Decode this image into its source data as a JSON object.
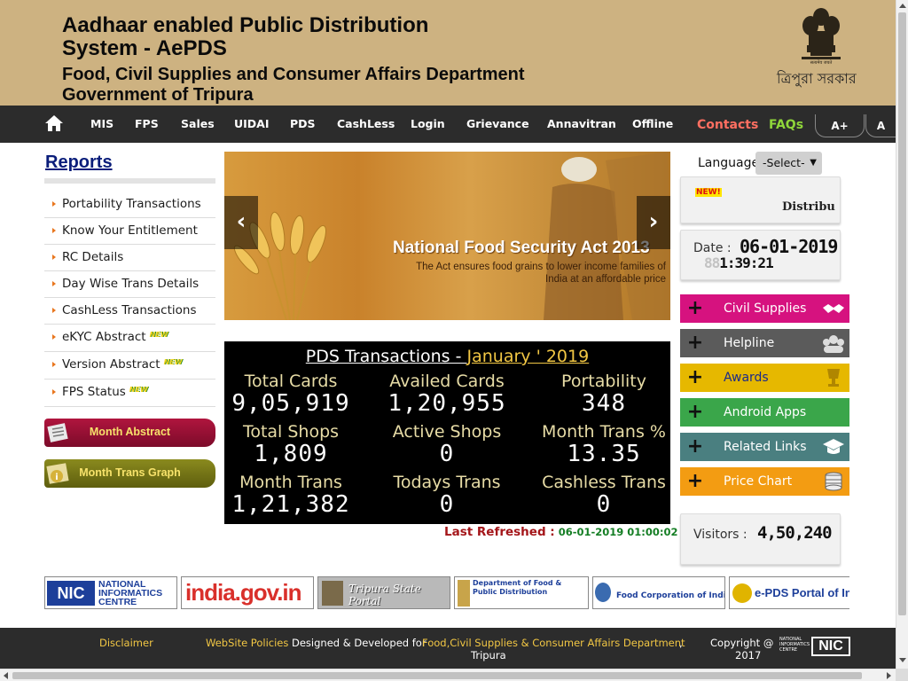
{
  "header": {
    "title": "Aadhaar enabled Public Distribution System - AePDS",
    "department": "Food, Civil Supplies and Consumer Affairs Department",
    "government": "Government of Tripura",
    "emblem_caption": "ত্রিপুরা সরকার",
    "bg_color": "#cdb281"
  },
  "nav": {
    "home_icon": "home-icon",
    "items": [
      "MIS",
      "FPS",
      "Sales",
      "UIDAI",
      "PDS",
      "CashLess",
      "Login",
      "Grievance",
      "Annavitran",
      "Offline"
    ],
    "contacts": "Contacts",
    "faqs": "FAQs",
    "font_increase": "A+",
    "font_normal": "A"
  },
  "reports": {
    "title": "Reports",
    "items": [
      {
        "label": "Portability Transactions",
        "new": false
      },
      {
        "label": "Know Your Entitlement",
        "new": false
      },
      {
        "label": "RC Details",
        "new": false
      },
      {
        "label": "Day Wise Trans Details",
        "new": false
      },
      {
        "label": "CashLess Transactions",
        "new": false
      },
      {
        "label": "eKYC Abstract",
        "new": true
      },
      {
        "label": "Version Abstract",
        "new": true
      },
      {
        "label": "FPS Status",
        "new": true
      }
    ],
    "new_badge": "NEW",
    "month_abstract": "Month Abstract",
    "month_trans_graph": "Month Trans Graph"
  },
  "banner": {
    "title": "National Food Security Act 2013",
    "subtitle": "The Act ensures food grains to lower income families of India at an affordable price",
    "prev": "‹",
    "next": "›"
  },
  "stats": {
    "heading_label": "PDS Transactions - ",
    "heading_month": "January ' 2019",
    "cells": [
      {
        "label": "Total Cards",
        "value": "9,05,919"
      },
      {
        "label": "Availed Cards",
        "value": "1,20,955"
      },
      {
        "label": "Portability",
        "value": "348"
      },
      {
        "label": "Total Shops",
        "value": "1,809"
      },
      {
        "label": "Active Shops",
        "value": "0"
      },
      {
        "label": "Month Trans %",
        "value": "13.35"
      },
      {
        "label": "Month Trans",
        "value": "1,21,382"
      },
      {
        "label": "Todays Trans",
        "value": "0"
      },
      {
        "label": "Cashless Trans",
        "value": "0"
      }
    ],
    "last_refreshed_label": "Last Refreshed :",
    "last_refreshed_value": "06-01-2019  01:00:02"
  },
  "right": {
    "language_label": "Language",
    "language_selected": "-Select-",
    "news_tag": "NEW!",
    "news_text": "Distribu",
    "date_label": "Date :",
    "date_value": "06-01-2019",
    "time_ghost": "88",
    "time_value": "1:39:21",
    "quick_links": [
      {
        "label": "Civil Supplies",
        "color": "#d6127f",
        "icon": "handshake-icon"
      },
      {
        "label": "Helpline",
        "color": "#5b5b5b",
        "icon": "people-icon"
      },
      {
        "label": "Awards",
        "color": "#e6b800",
        "icon": "trophy-icon"
      },
      {
        "label": "Android Apps",
        "color": "#3aa64a",
        "icon": "android-icon"
      },
      {
        "label": "Related Links",
        "color": "#4a7f80",
        "icon": "graduation-cap-icon"
      },
      {
        "label": "Price Chart",
        "color": "#f39c12",
        "icon": "coins-icon"
      }
    ],
    "visitors_label": "Visitors :",
    "visitors_value": "4,50,240"
  },
  "logos": {
    "nic": "NATIONAL INFORMATICS CENTRE",
    "india_gov": "india.gov.in",
    "tripura_portal": "Tripura State Portal",
    "dfpd": "Department of Food & Public Distribution",
    "fci": "Food Corporation of India",
    "epds": "e-PDS Portal of Ind"
  },
  "footer": {
    "disclaimer": "Disclaimer",
    "policies": "WebSite Policies",
    "designed_for": "Designed & Developed for",
    "dept": "Food,Civil Supplies & Consumer Affairs Department",
    "comma": ",",
    "state": "Tripura",
    "copyright": "Copyright @",
    "year": "2017"
  }
}
